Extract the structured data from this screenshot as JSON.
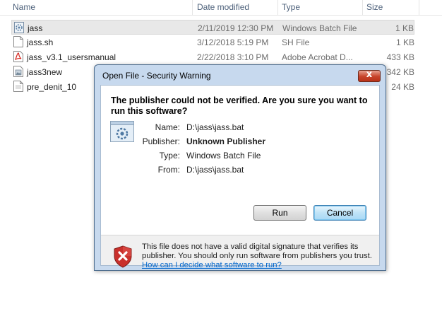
{
  "columns": {
    "name": "Name",
    "date": "Date modified",
    "type": "Type",
    "size": "Size"
  },
  "files": [
    {
      "name": "jass",
      "date": "2/11/2019 12:30 PM",
      "type": "Windows Batch File",
      "size": "1 KB",
      "icon": "batch-file-icon",
      "selected": true
    },
    {
      "name": "jass.sh",
      "date": "3/12/2018 5:19 PM",
      "type": "SH File",
      "size": "1 KB",
      "icon": "text-file-icon"
    },
    {
      "name": "jass_v3.1_usersmanual",
      "date": "2/22/2018 3:10 PM",
      "type": "Adobe Acrobat D...",
      "size": "433 KB",
      "icon": "pdf-file-icon"
    },
    {
      "name": "jass3new",
      "date": "",
      "type": "",
      "size": "342 KB",
      "icon": "image-file-icon"
    },
    {
      "name": "pre_denit_10",
      "date": "",
      "type": "",
      "size": "24 KB",
      "icon": "text-file-icon"
    }
  ],
  "dialog": {
    "title": "Open File - Security Warning",
    "heading": "The publisher could not be verified.  Are you sure you want to run this software?",
    "fields": {
      "name_label": "Name:",
      "name_value": "D:\\jass\\jass.bat",
      "publisher_label": "Publisher:",
      "publisher_value": "Unknown Publisher",
      "type_label": "Type:",
      "type_value": "Windows Batch File",
      "from_label": "From:",
      "from_value": "D:\\jass\\jass.bat"
    },
    "run_label": "Run",
    "cancel_label": "Cancel",
    "warning_text": "This file does not have a valid digital signature that verifies its publisher.  You should only run software from publishers you trust.",
    "help_link": "How can I decide what software to run?",
    "close_glyph": "x"
  },
  "colors": {
    "accent": "#3c7fb1",
    "link": "#0066cc",
    "dialog_frame": "#c7d9ee",
    "close_red": "#c7422a"
  }
}
